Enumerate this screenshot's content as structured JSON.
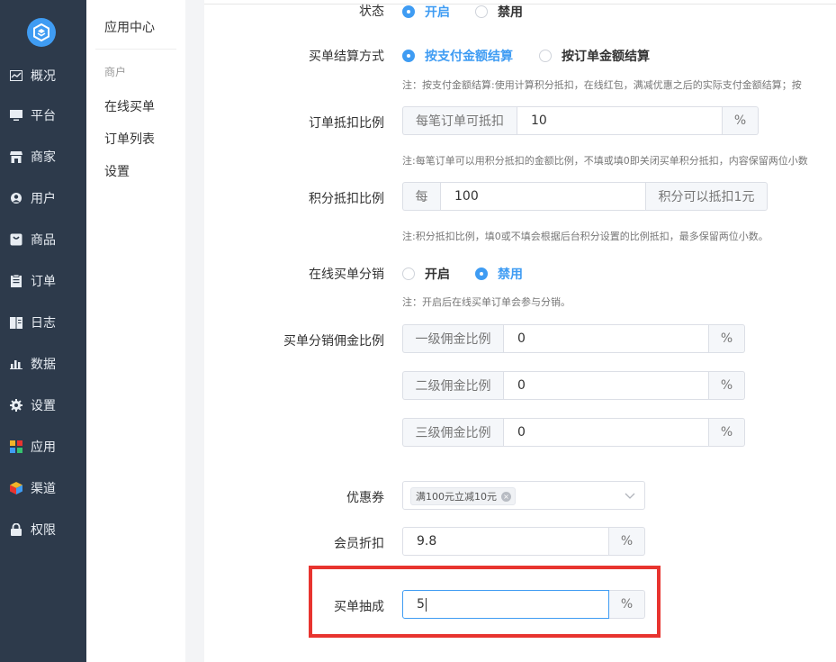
{
  "sidebar": {
    "items": [
      {
        "label": "概况",
        "icon": "chart-icon"
      },
      {
        "label": "平台",
        "icon": "monitor-icon"
      },
      {
        "label": "商家",
        "icon": "store-icon"
      },
      {
        "label": "用户",
        "icon": "user-icon"
      },
      {
        "label": "商品",
        "icon": "bag-icon"
      },
      {
        "label": "订单",
        "icon": "clipboard-icon"
      },
      {
        "label": "日志",
        "icon": "book-icon"
      },
      {
        "label": "数据",
        "icon": "bar-chart-icon"
      },
      {
        "label": "设置",
        "icon": "gear-icon"
      },
      {
        "label": "应用",
        "icon": "apps-icon"
      },
      {
        "label": "渠道",
        "icon": "cube-icon"
      },
      {
        "label": "权限",
        "icon": "lock-icon"
      }
    ]
  },
  "subnav": {
    "title": "应用中心",
    "group": "商户",
    "items": [
      "在线买单",
      "订单列表",
      "设置"
    ]
  },
  "form": {
    "status": {
      "label": "状态",
      "options": [
        "开启",
        "禁用"
      ],
      "selected": "开启"
    },
    "settle": {
      "label": "买单结算方式",
      "options": [
        "按支付金额结算",
        "按订单金额结算"
      ],
      "selected": "按支付金额结算",
      "note": "注：按支付金额结算:使用计算积分抵扣，在线红包，满减优惠之后的实际支付金额结算；按"
    },
    "order_deduct": {
      "label": "订单抵扣比例",
      "prefix": "每笔订单可抵扣",
      "value": "10",
      "suffix": "%",
      "note": "注:每笔订单可以用积分抵扣的金额比例，不填或填0即关闭买单积分抵扣，内容保留两位小数"
    },
    "points_deduct": {
      "label": "积分抵扣比例",
      "prefix": "每",
      "value": "100",
      "suffix": "积分可以抵扣1元",
      "note": "注:积分抵扣比例，填0或不填会根据后台积分设置的比例抵扣，最多保留两位小数。"
    },
    "distribution": {
      "label": "在线买单分销",
      "options": [
        "开启",
        "禁用"
      ],
      "selected": "禁用",
      "note": "注：开启后在线买单订单会参与分销。"
    },
    "commission": {
      "label": "买单分销佣金比例",
      "rows": [
        {
          "prefix": "一级佣金比例",
          "value": "0",
          "suffix": "%"
        },
        {
          "prefix": "二级佣金比例",
          "value": "0",
          "suffix": "%"
        },
        {
          "prefix": "三级佣金比例",
          "value": "0",
          "suffix": "%"
        }
      ]
    },
    "coupon": {
      "label": "优惠券",
      "tag": "满100元立减10元"
    },
    "member_discount": {
      "label": "会员折扣",
      "value": "9.8",
      "suffix": "%"
    },
    "cut": {
      "label": "买单抽成",
      "value": "5",
      "suffix": "%"
    }
  },
  "colors": {
    "accent": "#3f9cf3",
    "sidebar": "#2d3a4b",
    "highlight": "#e8342f"
  }
}
